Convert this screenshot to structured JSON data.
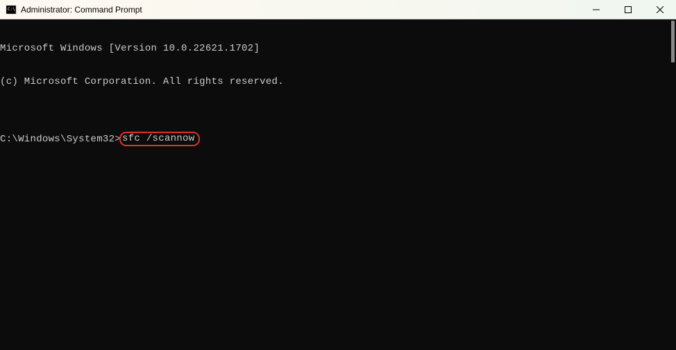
{
  "titlebar": {
    "title": "Administrator: Command Prompt"
  },
  "terminal": {
    "line1": "Microsoft Windows [Version 10.0.22621.1702]",
    "line2": "(c) Microsoft Corporation. All rights reserved.",
    "blank": "",
    "prompt": "C:\\Windows\\System32>",
    "command": "sfc /scannow"
  }
}
